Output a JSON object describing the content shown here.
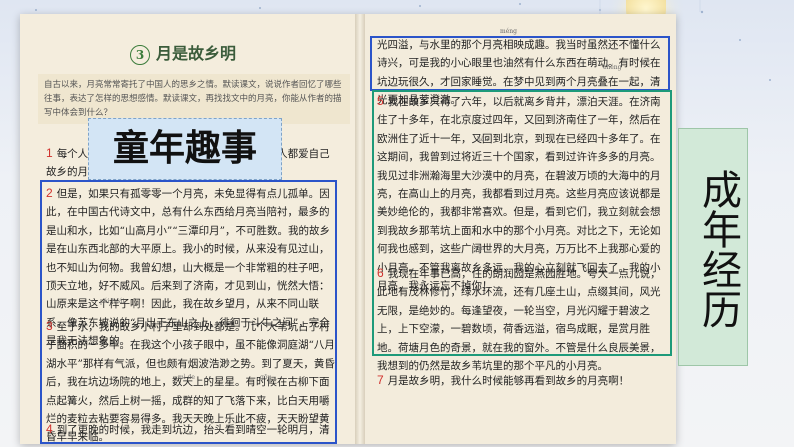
{
  "lesson": {
    "number": "3",
    "title": "月是故乡明"
  },
  "intro_text": "自古以来，月亮常常寄托了中国人的思乡之情。默读课文，说说作者回忆了哪些往事，表达了怎样的思想感情。默读课文，再找找文中的月亮，你能从作者的描写中体会到什么？",
  "labels": {
    "childhood": "童年趣事",
    "adult": "成年经历"
  },
  "left_page": {
    "p1": {
      "num": "1",
      "text": "每个人都有个故乡，人人的故乡都有个月亮。人人都爱自己故乡的月亮，事情大概就是如此吧。"
    },
    "p2": {
      "num": "2",
      "text": "但是，如果只有孤零零一个月亮，未免显得有点儿孤单。因此，在中国古代诗文中，总有什么东西给月亮当陪衬，最多的是山和水，比如“山高月小”“三潭印月”，不可胜数。我的故乡是在山东西北部的大平原上。我小的时候，从来没有见过山，也不知山为何物。我曾幻想，山大概是一个非常粗的柱子吧，顶天立地，好不威风。后来到了济南，才见到山，恍然大悟：山原来是这个样子啊！因此，我在故乡望月，从来不同山联系。像苏东坡说的“月出于东山之上，徘徊于斗牛之间”，完全是我无法想象的。"
    },
    "p3": {
      "num": "3",
      "text": "至于水，我的故乡小村子里却到处都是。几个大苇坑占了村子面积的一多半。在我这个小孩子眼中，虽不能像洞庭湖“八月湖水平”那样有气派，但也颇有烟波浩渺之势。到了夏天，黄昏后，我在坑边场院的地上，数天上的星星。有时候在古柳下面点起篝火，然后上树一摇，成群的知了飞落下来，比白天用嚼烂的麦粒去粘要容易得多。我天天晚上乐此不疲，天天盼望黄昏早早来临。"
    },
    "p4": {
      "num": "4",
      "text": "到了更晚的时候，我走到坑边，抬头看到晴空一轮明月，清"
    },
    "pinyin": {
      "fulai": "pái huái",
      "mide": "mì de",
      "gou": "gōu"
    }
  },
  "right_page": {
    "p4_cont": {
      "text": "光四溢，与水里的那个月亮相映成趣。我当时虽然还不懂什么诗兴，可是我的小心眼里也油然有什么东西在萌动。有时候在坑边玩很久，才回家睡觉。在梦中见到两个月亮叠在一起，清光更加晶莹澄澈。"
    },
    "p5": {
      "num": "5",
      "text": "我在故乡只待了六年，以后就离乡背井，漂泊天涯。在济南住了十多年，在北京度过四年，又回到济南住了一年，然后在欧洲住了近十一年，又回到北京，到现在已经四十多年了。在这期间，我曾到过将近三十个国家，看到过许许多多的月亮。我见过非洲瀚海里大沙漠中的月亮，在碧波万顷的大海中的月亮，在高山上的月亮，我都看到过月亮。这些月亮应该说都是美妙绝伦的，我都非常喜欢。但是，看到它们，我立刻就会想到我故乡那苇坑上面和水中的那个小月亮。对比之下，无论如何我也感到，这些广阔世界的大月亮，万万比不上我那心爱的小月亮。不管我离故乡多远，我的心立刻就飞回去了。我的小月亮，我永远忘不掉你！"
    },
    "p6": {
      "num": "6",
      "text": "我现在年事已高，住的朗润园是燕园胜地。夸大一点儿说，此地有茂林修竹，绿水环流，还有几座土山，点缀其间，风光无限，是绝妙的。每逢望夜，一轮当空，月光闪耀于碧波之上，上下空濛，一碧数顷，荷香远溢，宿鸟成眠，是赏月胜地。荷塘月色的奇景，就在我的窗外。不管是什么良辰美景，我想到的仍然是故乡苇坑里的那个平凡的小月亮。"
    },
    "p7": {
      "num": "7",
      "text": "月是故乡明，我什么时候能够再看到故乡的月亮啊！"
    },
    "pinyin": {
      "meng": "méng",
      "cheng": "chéng",
      "yin": "yín",
      "han": "hàn"
    }
  },
  "colors": {
    "blue_box": "#2b54c9",
    "green_box": "#1e9a7a",
    "para_number": "#d0312d"
  }
}
